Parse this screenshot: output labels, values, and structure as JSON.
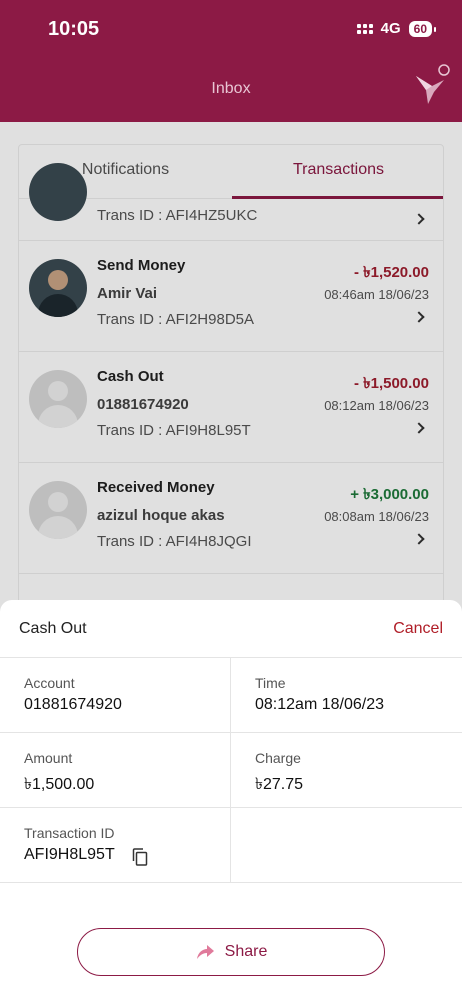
{
  "status_bar": {
    "time": "10:05",
    "network": "4G",
    "battery": "60"
  },
  "header": {
    "title": "Inbox",
    "logo_icon": "bird-logo-icon"
  },
  "tabs": [
    {
      "label": "Notifications",
      "active": false
    },
    {
      "label": "Transactions",
      "active": true
    }
  ],
  "transactions": [
    {
      "partial": true,
      "trans_id": "Trans ID : AFI4HZ5UKC"
    },
    {
      "type": "Send Money",
      "party": "Amir Vai",
      "trans_id": "Trans ID : AFI2H98D5A",
      "amount": "- ৳1,520.00",
      "direction": "debit",
      "datetime": "08:46am 18/06/23",
      "avatar": "photo"
    },
    {
      "type": "Cash Out",
      "party": "01881674920",
      "trans_id": "Trans ID : AFI9H8L95T",
      "amount": "- ৳1,500.00",
      "direction": "debit",
      "datetime": "08:12am 18/06/23",
      "avatar": "placeholder"
    },
    {
      "type": "Received Money",
      "party": "azizul hoque akas",
      "trans_id": "Trans ID : AFI4H8JQGI",
      "amount": "+ ৳3,000.00",
      "direction": "credit",
      "datetime": "08:08am 18/06/23",
      "avatar": "placeholder"
    }
  ],
  "sheet": {
    "title": "Cash Out",
    "cancel_label": "Cancel",
    "account_label": "Account",
    "account_value": "01881674920",
    "time_label": "Time",
    "time_value": "08:12am 18/06/23",
    "amount_label": "Amount",
    "amount_value": "৳1,500.00",
    "charge_label": "Charge",
    "charge_value": "৳27.75",
    "txid_label": "Transaction ID",
    "txid_value": "AFI9H8L95T",
    "share_label": "Share"
  },
  "colors": {
    "brand": "#8c1a45",
    "debit": "#a01e2f",
    "credit": "#1f7a3c",
    "cancel": "#b01e28"
  }
}
